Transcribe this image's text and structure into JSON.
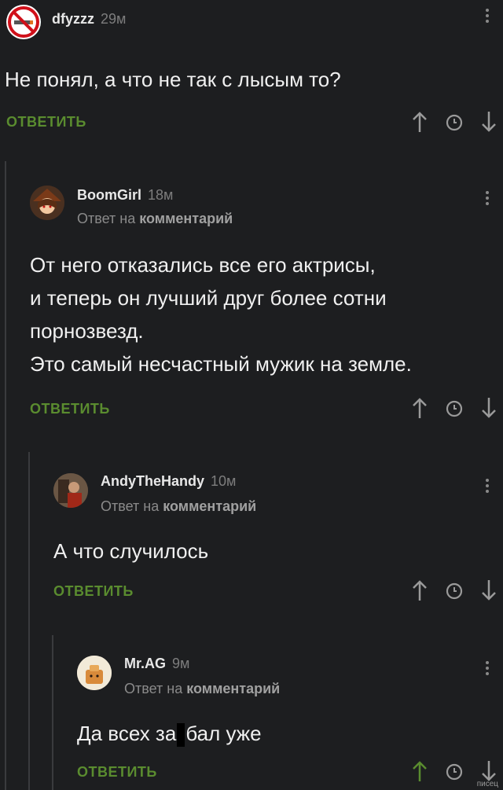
{
  "comments": [
    {
      "username": "dfyzzz",
      "time": "29м",
      "reply_to": "",
      "text_lines": [
        "Не понял, а что не так с лысым то?"
      ],
      "reply_label": "ОТВЕТИТЬ",
      "avatar_icon": "no-smoking-icon"
    },
    {
      "username": "BoomGirl",
      "time": "18м",
      "reply_to_prefix": "Ответ на",
      "reply_to_link": "комментарий",
      "text_lines": [
        "От него отказались все его актрисы,",
        "и теперь он лучший друг более сотни",
        "порнозвезд.",
        "Это самый несчастный мужик на земле."
      ],
      "reply_label": "ОТВЕТИТЬ",
      "avatar_icon": "anime-girl-avatar"
    },
    {
      "username": "AndyTheHandy",
      "time": "10м",
      "reply_to_prefix": "Ответ на",
      "reply_to_link": "комментарий",
      "text_lines": [
        "А что случилось"
      ],
      "reply_label": "ОТВЕТИТЬ",
      "avatar_icon": "photo-avatar"
    },
    {
      "username": "Mr.AG",
      "time": "9м",
      "reply_to_prefix": "Ответ на",
      "reply_to_link": "комментарий",
      "text_before": "Да всех за",
      "text_after": "бал уже",
      "reply_label": "ОТВЕТИТЬ",
      "avatar_icon": "toast-avatar"
    }
  ],
  "colors": {
    "background": "#1d1e20",
    "reply": "#5a8c2f",
    "upvote_active": "#5a8c2f"
  },
  "watermark": "писец"
}
